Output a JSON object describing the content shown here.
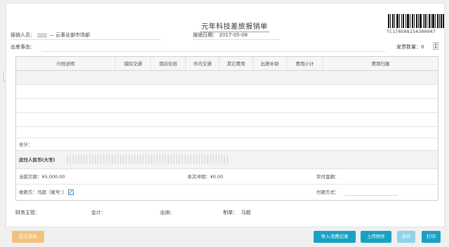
{
  "form": {
    "title": "元年科技差旅报销单",
    "barcode_number": "TC170508154300947"
  },
  "header": {
    "submitter_label": "报销人员：",
    "submitter_value": "— 云事业部市场部",
    "date_label": "报销日期：",
    "date_value": "2017-05-08",
    "trip_reason_label": "出差事由：",
    "invoice_count_label": "发票数量：",
    "invoice_count_value": "0"
  },
  "table": {
    "columns": [
      "行程说明",
      "城际交通",
      "酒店住宿",
      "市内交通",
      "其它费用",
      "出差补助",
      "费用小计",
      "费用归属"
    ]
  },
  "summary": {
    "total_label": "合计：",
    "capital_label": "应付人民币(大写)",
    "debt_label": "当前欠款：",
    "debt_value": "¥5,000.00",
    "offset_label": "本次冲销：",
    "offset_value": "¥0.00",
    "actual_label": "实付金额：",
    "payee_label": "收款方：",
    "payee_value": "马超（尾号：）",
    "payment_method_label": "付款方式："
  },
  "signatures": {
    "finance_label": "财务主管：",
    "accountant_label": "会计：",
    "cashier_label": "出纳：",
    "preparer_label": "制单：",
    "preparer_value": "马超"
  },
  "buttons": {
    "submit": "提交审批",
    "import": "导入消费记录",
    "upload": "上传附件",
    "save": "保存",
    "print": "打印"
  },
  "colors": {
    "accent": "#17a2c4",
    "submit": "#f3c27a",
    "save_disabled": "#8fd3e6"
  },
  "icons": {
    "add_row": "plus-icon",
    "edit_payee": "edit-icon"
  }
}
